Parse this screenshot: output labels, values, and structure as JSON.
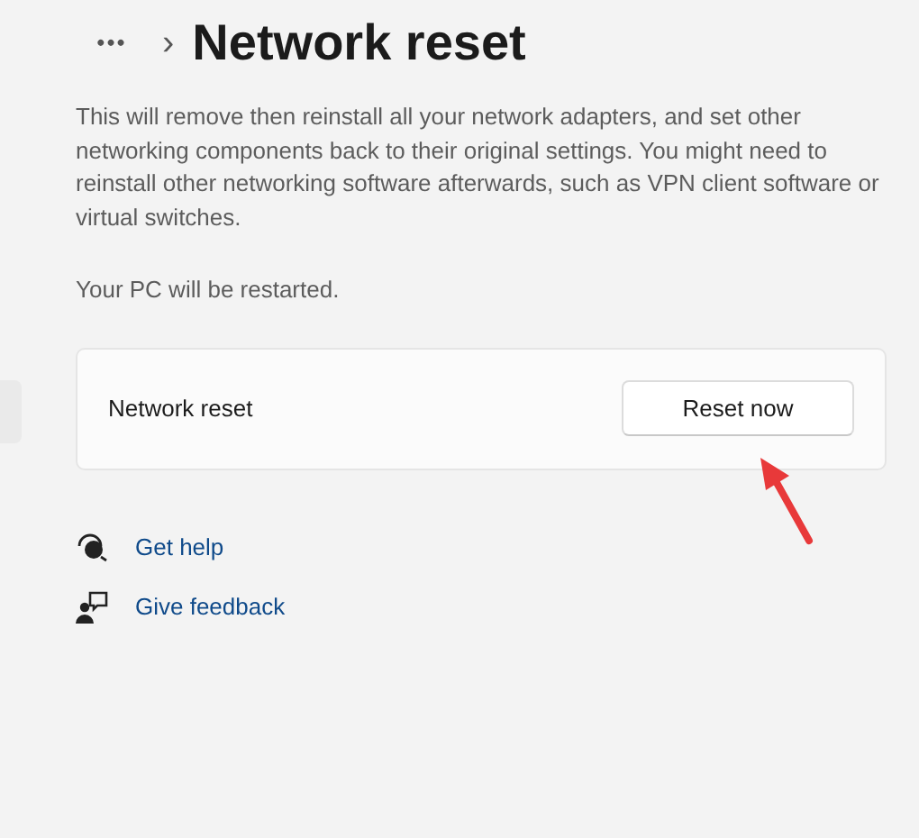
{
  "breadcrumb": {
    "overflow": "•••",
    "separator": "›",
    "title": "Network reset"
  },
  "description": "This will remove then reinstall all your network adapters, and set other networking components back to their original settings. You might need to reinstall other networking software afterwards, such as VPN client software or virtual switches.",
  "restart_note": "Your PC will be restarted.",
  "card": {
    "label": "Network reset",
    "button": "Reset now"
  },
  "links": [
    {
      "kind": "help",
      "label": "Get help"
    },
    {
      "kind": "feedback",
      "label": "Give feedback"
    }
  ]
}
